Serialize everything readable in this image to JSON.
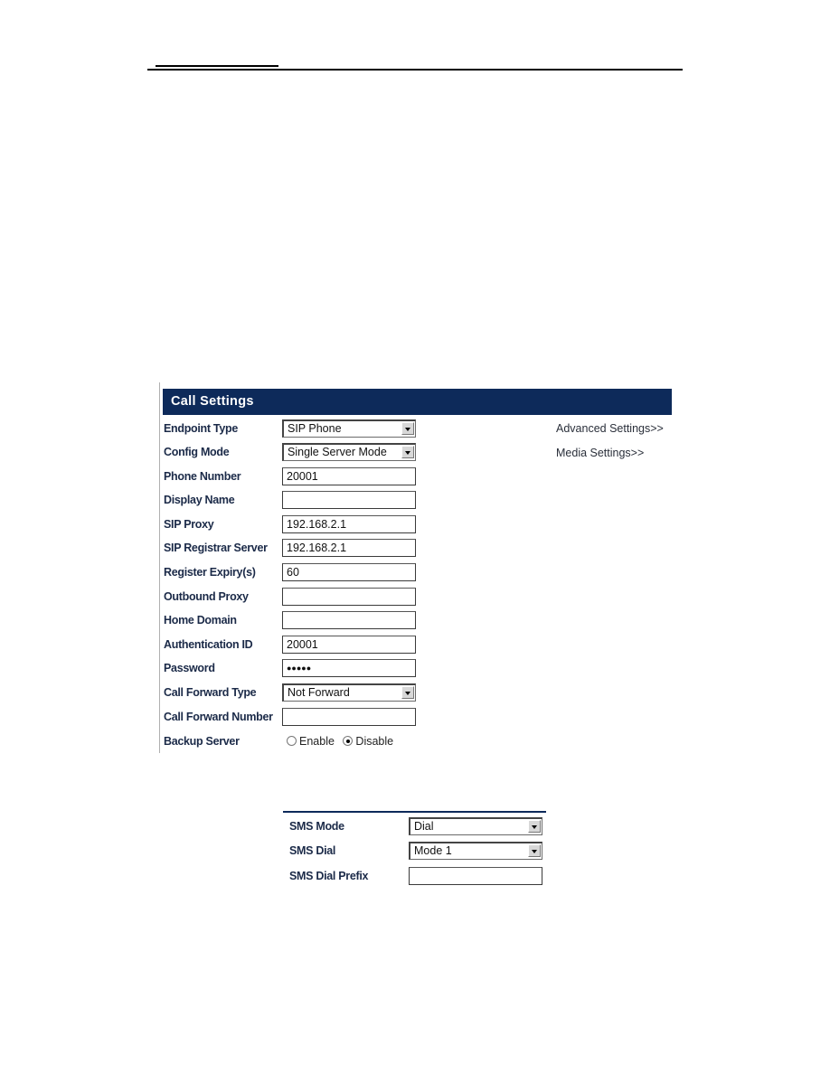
{
  "panel": {
    "title": "Call Settings",
    "links": {
      "advanced": "Advanced Settings>>",
      "media": "Media Settings>>"
    },
    "rows": [
      {
        "label": "Endpoint Type",
        "type": "select",
        "value": "SIP Phone"
      },
      {
        "label": "Config Mode",
        "type": "select",
        "value": "Single Server Mode"
      },
      {
        "label": "Phone Number",
        "type": "input",
        "value": "20001"
      },
      {
        "label": "Display Name",
        "type": "input",
        "value": ""
      },
      {
        "label": "SIP Proxy",
        "type": "input",
        "value": "192.168.2.1"
      },
      {
        "label": "SIP Registrar Server",
        "type": "input",
        "value": "192.168.2.1"
      },
      {
        "label": "Register Expiry(s)",
        "type": "input",
        "value": "60"
      },
      {
        "label": "Outbound Proxy",
        "type": "input",
        "value": ""
      },
      {
        "label": "Home Domain",
        "type": "input",
        "value": ""
      },
      {
        "label": "Authentication ID",
        "type": "input",
        "value": "20001"
      },
      {
        "label": "Password",
        "type": "password",
        "value": "●●●●●"
      },
      {
        "label": "Call Forward Type",
        "type": "select",
        "value": "Not Forward"
      },
      {
        "label": "Call Forward Number",
        "type": "input",
        "value": ""
      },
      {
        "label": "Backup Server",
        "type": "radio",
        "options": [
          "Enable",
          "Disable"
        ],
        "selected": "Disable"
      }
    ]
  },
  "sms": {
    "rows": [
      {
        "label": "SMS Mode",
        "type": "select",
        "value": "Dial"
      },
      {
        "label": "SMS Dial",
        "type": "select",
        "value": "Mode 1"
      },
      {
        "label": "SMS Dial Prefix",
        "type": "input",
        "value": ""
      }
    ]
  }
}
